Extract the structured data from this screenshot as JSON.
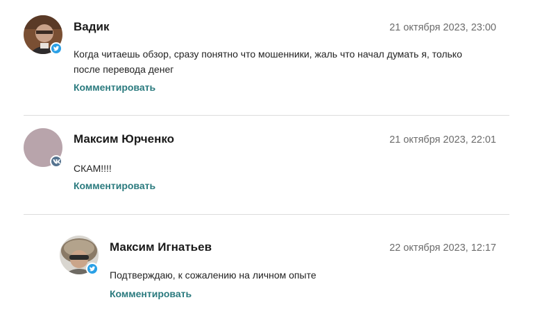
{
  "comments": [
    {
      "author": "Вадик",
      "date": "21 октября 2023, 23:00",
      "text": "Когда читаешь обзор, сразу понятно что мошенники, жаль что начал думать я, только после перевода денег",
      "reply_label": "Комментировать",
      "network": "twitter-icon"
    },
    {
      "author": "Максим Юрченко",
      "date": "21 октября 2023, 22:01",
      "text": "СКАМ!!!!",
      "reply_label": "Комментировать",
      "network": "vk-icon"
    },
    {
      "author": "Максим Игнатьев",
      "date": "22 октября 2023, 12:17",
      "text": "Подтверждаю, к сожалению на личном опыте",
      "reply_label": "Комментировать",
      "network": "twitter-icon"
    }
  ],
  "colors": {
    "accent": "#2a7a7e",
    "twitter": "#2aa0e6",
    "vk": "#55738f",
    "divider": "#dcdcdc"
  }
}
